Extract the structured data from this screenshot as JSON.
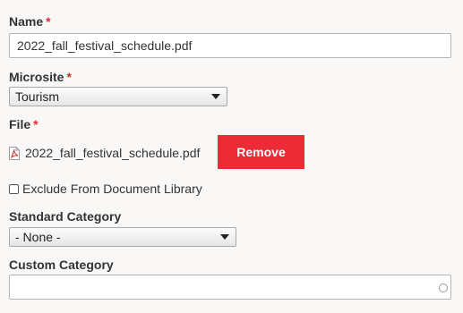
{
  "name": {
    "label": "Name",
    "required_mark": "*",
    "value": "2022_fall_festival_schedule.pdf"
  },
  "microsite": {
    "label": "Microsite",
    "required_mark": "*",
    "selected": "Tourism"
  },
  "file": {
    "label": "File",
    "required_mark": "*",
    "file_name": "2022_fall_festival_schedule.pdf",
    "icon": "pdf-file-icon",
    "remove_label": "Remove"
  },
  "exclude_from_library": {
    "label": "Exclude From Document Library",
    "checked": false
  },
  "standard_category": {
    "label": "Standard Category",
    "selected": "- None -"
  },
  "custom_category": {
    "label": "Custom Category",
    "value": "",
    "icon": "circle-icon"
  },
  "colors": {
    "required": "#e3262e",
    "remove_button": "#eb2c36",
    "background": "#f9f8f6"
  }
}
